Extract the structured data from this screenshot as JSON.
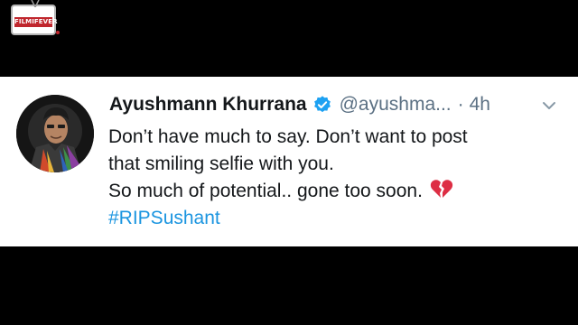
{
  "watermark": {
    "logo_text": "FILMIFEVER",
    "accent": "#c0262d"
  },
  "tweet": {
    "author_name": "Ayushmann Khurrana",
    "handle": "@ayushma...",
    "separator": "·",
    "time": "4h",
    "lines": [
      "Don’t have much to say. Don’t want to post",
      "that smiling selfie with you.",
      "So much of potential.. gone too soon."
    ],
    "hashtag": "#RIPSushant",
    "emoji": "broken-heart-icon",
    "verified_color": "#1da1f2",
    "hashtag_color": "#1b95e0"
  }
}
